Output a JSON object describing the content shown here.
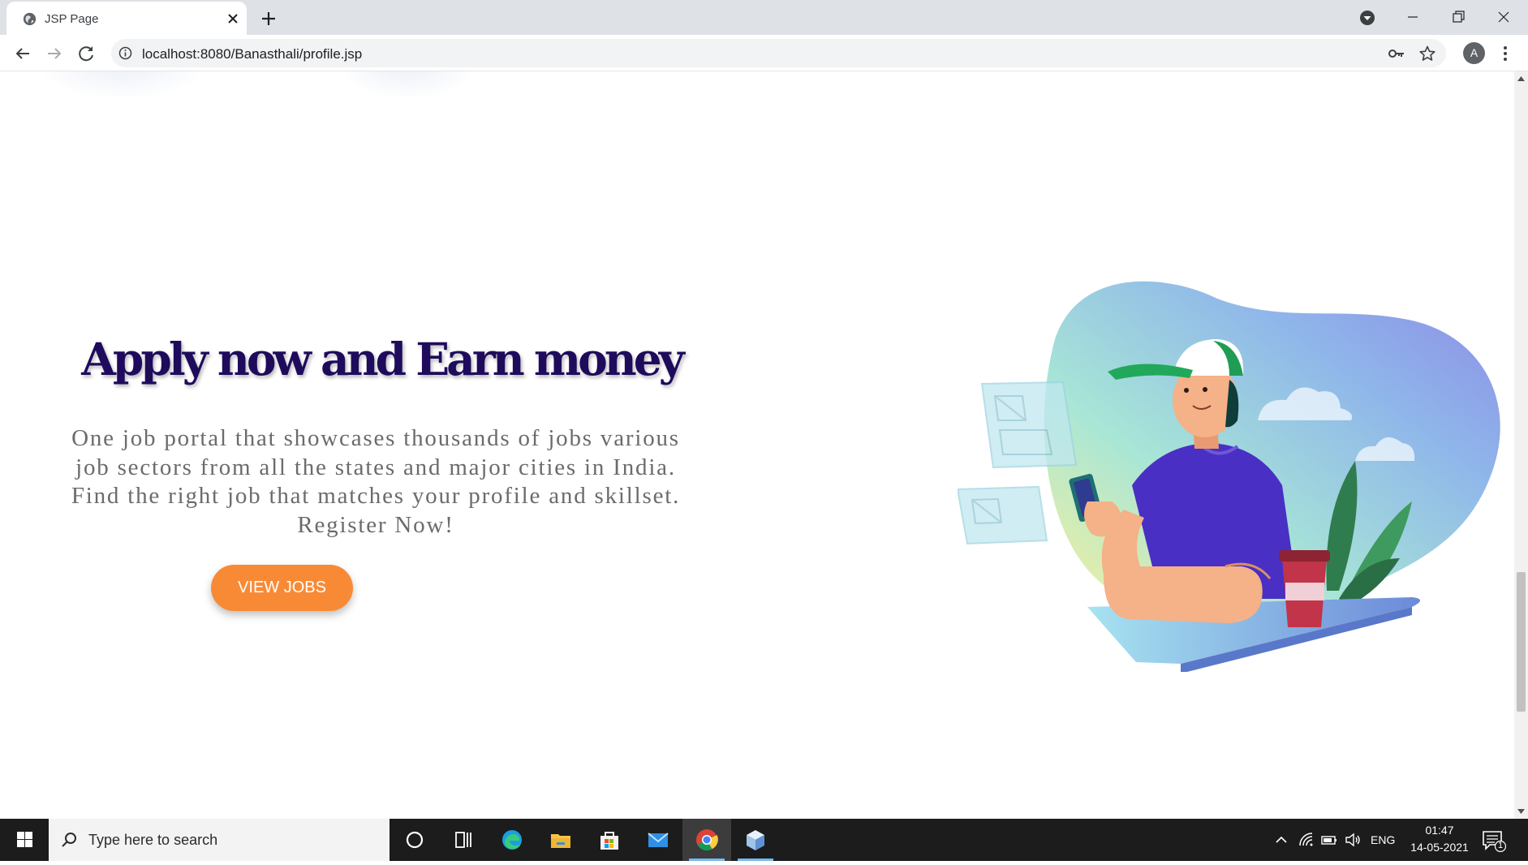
{
  "browser": {
    "tab": {
      "title": "JSP Page"
    },
    "omnibox": {
      "url": "localhost:8080/Banasthali/profile.jsp"
    },
    "profile_initial": "A"
  },
  "page": {
    "hero": {
      "title": "Apply now and Earn money",
      "description_lines": [
        "One job portal that showcases thousands of jobs various",
        "job sectors from all the states and major cities in India.",
        "Find the right job that matches your profile and skillset.",
        "Register Now!"
      ],
      "cta_label": "VIEW JOBS"
    },
    "colors": {
      "title": "#1f0b5c",
      "cta": "#f98a35",
      "text": "#6b6b6b"
    },
    "illustration": "person-with-phone-and-coffee-illustration"
  },
  "taskbar": {
    "search_placeholder": "Type here to search",
    "language": "ENG",
    "time": "01:47",
    "date": "14-05-2021",
    "notification_count": "1",
    "pinned": [
      "cortana-icon",
      "task-view-icon",
      "edge-icon",
      "file-explorer-icon",
      "store-icon",
      "mail-icon",
      "chrome-icon",
      "app-cube-icon"
    ]
  }
}
